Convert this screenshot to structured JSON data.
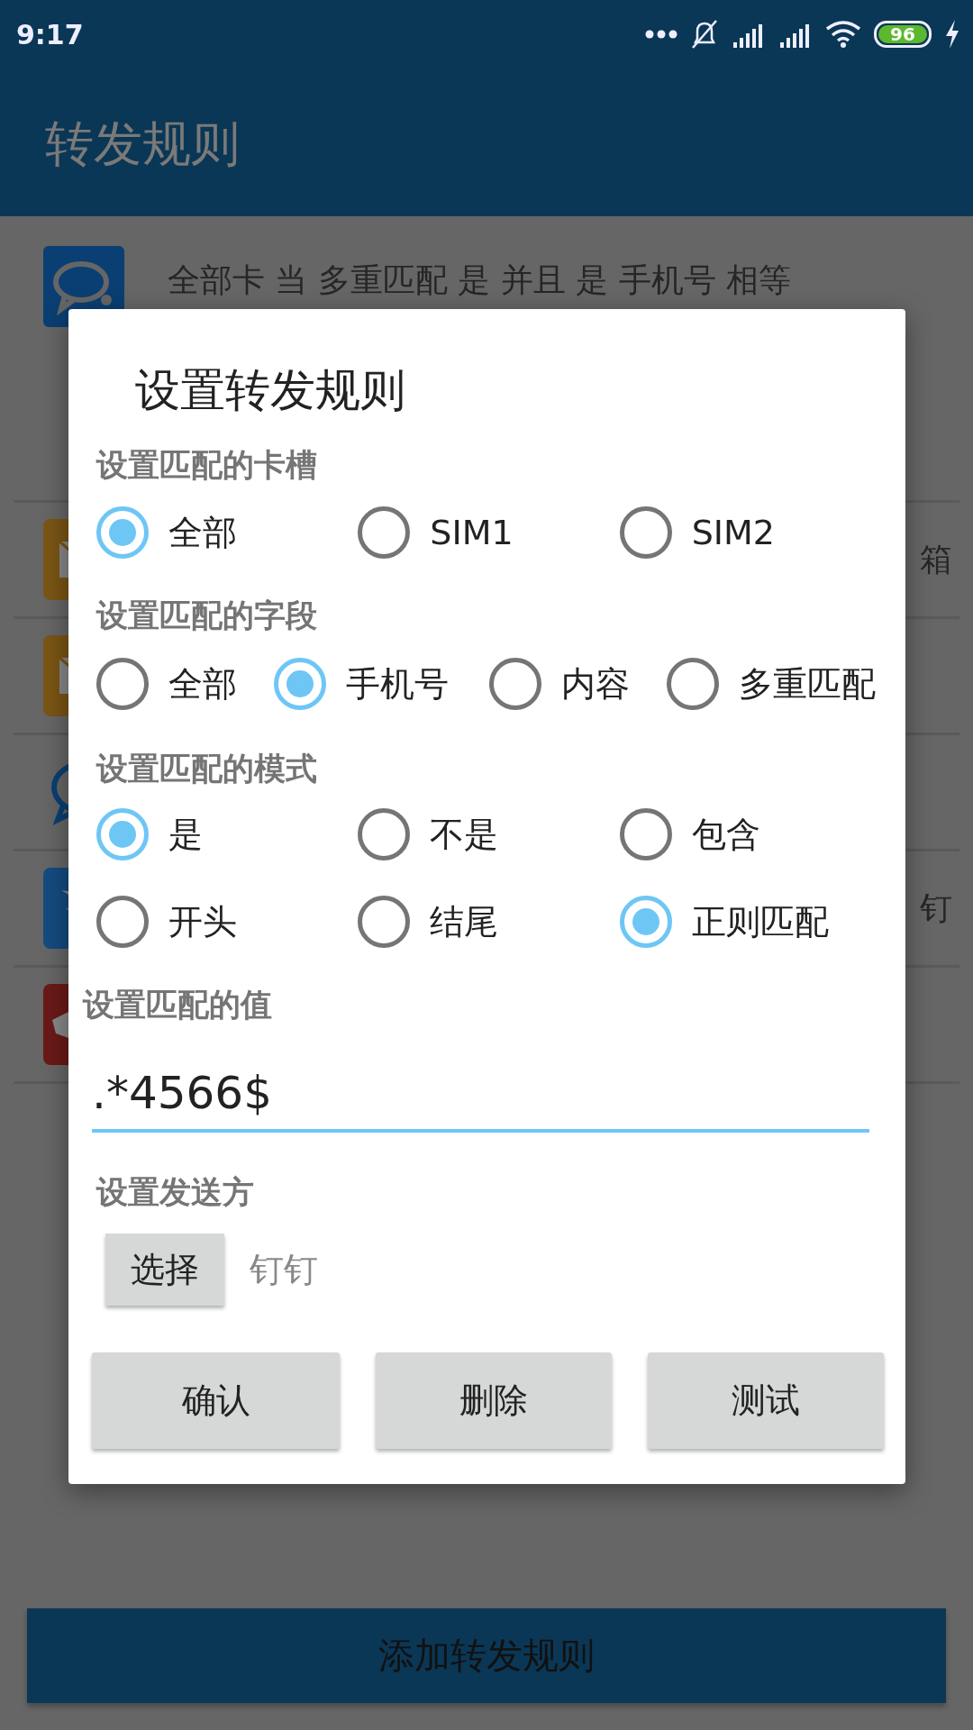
{
  "status_bar": {
    "time": "9:17",
    "battery": "96"
  },
  "app_bar": {
    "title": "转发规则"
  },
  "rules": [
    {
      "kind": "chat",
      "text": "全部卡 当 多重匹配 是 并且 是 手机号 相等"
    },
    {
      "kind": "mail",
      "text": "箱"
    },
    {
      "kind": "mail"
    },
    {
      "kind": "bubble"
    },
    {
      "kind": "wing",
      "text": "钉"
    },
    {
      "kind": "red"
    }
  ],
  "dialog": {
    "title": "设置转发规则",
    "sections": [
      {
        "label": "设置匹配的卡槽",
        "options": [
          {
            "label": "全部",
            "selected": true
          },
          {
            "label": "SIM1",
            "selected": false
          },
          {
            "label": "SIM2",
            "selected": false
          }
        ]
      },
      {
        "label": "设置匹配的字段",
        "options": [
          {
            "label": "全部",
            "selected": false
          },
          {
            "label": "手机号",
            "selected": true
          },
          {
            "label": "内容",
            "selected": false
          },
          {
            "label": "多重匹配",
            "selected": false
          }
        ]
      },
      {
        "label": "设置匹配的模式",
        "options": [
          {
            "label": "是",
            "selected": true
          },
          {
            "label": "不是",
            "selected": false
          },
          {
            "label": "包含",
            "selected": false
          },
          {
            "label": "开头",
            "selected": false
          },
          {
            "label": "结尾",
            "selected": false
          },
          {
            "label": "正则匹配",
            "selected": true
          }
        ]
      }
    ],
    "value_field": {
      "label": "设置匹配的值",
      "value": ".*4566$"
    },
    "sender": {
      "label": "设置发送方",
      "button": "选择",
      "value": "钉钉"
    },
    "buttons": [
      "确认",
      "删除",
      "测试"
    ]
  },
  "add_button": "添加转发规则"
}
